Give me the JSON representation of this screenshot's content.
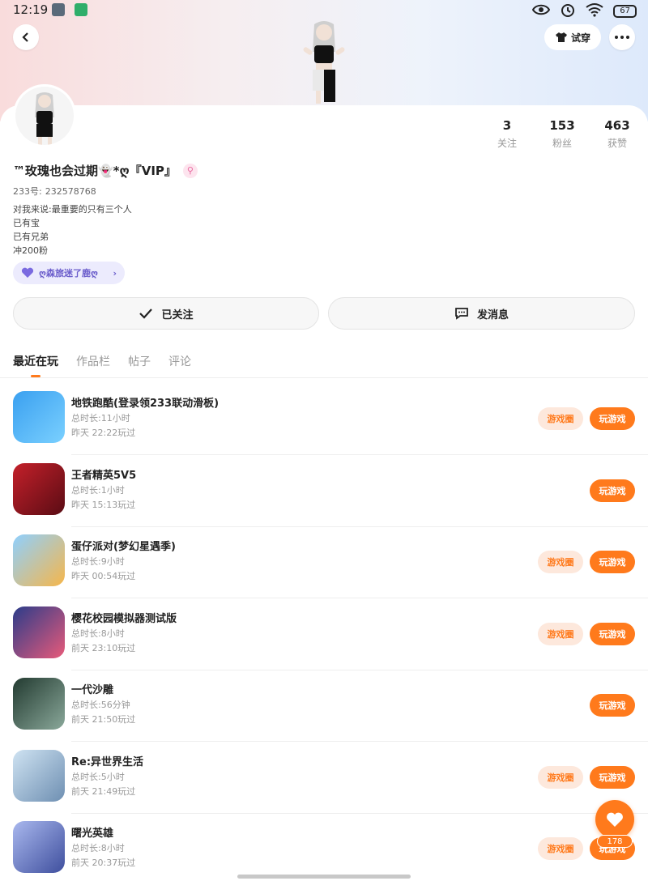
{
  "status_bar": {
    "time": "12:19",
    "battery": "67"
  },
  "header": {
    "try_on_label": "试穿"
  },
  "profile": {
    "name": "™玫瑰也会过期👻*ღ『VIP』",
    "id_label": "233号:",
    "id_value": "232578768",
    "bio": [
      "对我来说:最重要的只有三个人",
      "已有宝",
      "已有兄弟",
      "冲200粉"
    ],
    "chip_label": "ღ森旅迷了鹿ღ",
    "stats": [
      {
        "value": "3",
        "label": "关注"
      },
      {
        "value": "153",
        "label": "粉丝"
      },
      {
        "value": "463",
        "label": "获赞"
      }
    ]
  },
  "actions": {
    "follow_label": "已关注",
    "message_label": "发消息"
  },
  "tabs": [
    {
      "label": "最近在玩",
      "active": true
    },
    {
      "label": "作品栏",
      "active": false
    },
    {
      "label": "帖子",
      "active": false
    },
    {
      "label": "评论",
      "active": false
    }
  ],
  "games": [
    {
      "name": "地铁跑酷(登录领233联动滑板)",
      "duration": "总时长:11小时",
      "last_played": "昨天 22:22玩过",
      "has_circle": true,
      "icon_color": "#3aa0f0"
    },
    {
      "name": "王者精英5V5",
      "duration": "总时长:1小时",
      "last_played": "昨天 15:13玩过",
      "has_circle": false,
      "icon_color": "#c4202a"
    },
    {
      "name": "蛋仔派对(梦幻星遇季)",
      "duration": "总时长:9小时",
      "last_played": "昨天 00:54玩过",
      "has_circle": true,
      "icon_color": "#f6b64a"
    },
    {
      "name": "樱花校园模拟器测试版",
      "duration": "总时长:8小时",
      "last_played": "前天 23:10玩过",
      "has_circle": true,
      "icon_color": "#e85a7a"
    },
    {
      "name": "一代沙雕",
      "duration": "总时长:56分钟",
      "last_played": "前天 21:50玩过",
      "has_circle": false,
      "icon_color": "#3e6a55"
    },
    {
      "name": "Re:异世界生活",
      "duration": "总时长:5小时",
      "last_played": "前天 21:49玩过",
      "has_circle": true,
      "icon_color": "#8fb7d6"
    },
    {
      "name": "曙光英雄",
      "duration": "总时长:8小时",
      "last_played": "前天 20:37玩过",
      "has_circle": true,
      "icon_color": "#6f7fc8"
    }
  ],
  "game_buttons": {
    "circle_label": "游戏圈",
    "play_label": "玩游戏"
  },
  "fab": {
    "count": "178"
  }
}
